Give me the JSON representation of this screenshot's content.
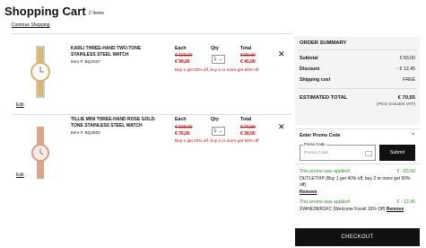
{
  "header": {
    "title": "Shopping Cart",
    "count": "2 Items",
    "continue": "Continue Shopping"
  },
  "columns": {
    "each": "Each",
    "qty": "Qty",
    "total": "Total"
  },
  "items": [
    {
      "name": "KARLI THREE-HAND TWO-TONE STAINLESS STEEL WATCH",
      "item_no": "Item #: BQ3337",
      "orig_each": "€ 129,00",
      "sale_each": "€ 90,00",
      "qty": "1",
      "orig_total": "€ 90,00",
      "sale_total": "€ 45,00",
      "promo": "Buy 1 get 40% off, buy 2 or more get 50% off",
      "edit": "Edit",
      "remove_icon": "close-icon"
    },
    {
      "name": "TILLIE MINI THREE-HAND ROSE GOLD-TONE STAINLESS STEEL WATCH",
      "item_no": "Item #: BQ3502",
      "orig_each": "€ 109,00",
      "sale_each": "€ 76,00",
      "qty": "1",
      "orig_total": "€ 76,00",
      "sale_total": "€ 38,00",
      "promo": "Buy 1 get 40% off, buy 2 or more get 50% off",
      "edit": "Edit",
      "remove_icon": "close-icon"
    }
  ],
  "summary": {
    "title": "ORDER SUMMARY",
    "subtotal_label": "Subtotal",
    "subtotal": "€ 83,00",
    "discount_label": "Discount",
    "discount": "- € 12,45",
    "shipping_label": "Shipping cost",
    "shipping": "FREE",
    "estimated_label": "ESTIMATED TOTAL",
    "estimated": "€ 70,55",
    "vat_note": "(Price includes VAT)",
    "promo_header": "Enter Promo Code",
    "promo_legend": "Promo Code",
    "promo_placeholder": "Promo Code",
    "submit": "Submit",
    "applied1": "This promo was applied!",
    "applied1_amount": "€ - 83,00",
    "applied1_desc": "OUTLETVIP (Buy 1 get 40% off, buy 2 or more get 50% off)",
    "remove1": "Remove",
    "applied2": "This promo was applied!",
    "applied2_amount": "€ - 12,45",
    "applied2_desc": "XWHE2WRSFC (Welcome Fossil 15% Off)",
    "remove2": "Remove",
    "checkout": "CHECKOUT"
  },
  "colors": {
    "sale": "#cc0000",
    "applied": "#3a8a2e",
    "dark": "#111111"
  }
}
